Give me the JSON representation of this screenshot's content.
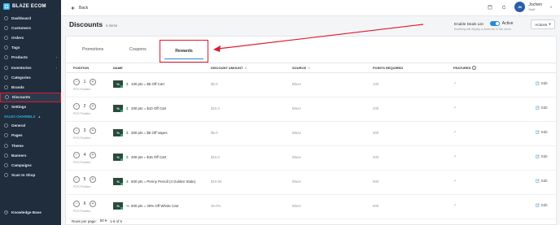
{
  "brand": {
    "name": "BLAZE ECOM"
  },
  "sidebar": {
    "items": [
      {
        "label": "Dashboard",
        "icon": "dashboard-icon"
      },
      {
        "label": "Customers",
        "icon": "people-icon"
      },
      {
        "label": "Orders",
        "icon": "orders-icon"
      },
      {
        "label": "Tags",
        "icon": "tag-icon"
      },
      {
        "label": "Products",
        "icon": "box-icon"
      },
      {
        "label": "Inventories",
        "icon": "inventory-icon"
      },
      {
        "label": "Categories",
        "icon": "category-icon"
      },
      {
        "label": "Brands",
        "icon": "brand-icon"
      },
      {
        "label": "Discounts",
        "icon": "discount-icon",
        "active": true
      },
      {
        "label": "Settings",
        "icon": "gear-icon"
      }
    ],
    "section_label": "SALES CHANNELS",
    "channel_items": [
      {
        "label": "General",
        "icon": "globe-icon"
      },
      {
        "label": "Pages",
        "icon": "pages-icon"
      },
      {
        "label": "Theme",
        "icon": "theme-icon"
      },
      {
        "label": "Banners",
        "icon": "banner-icon"
      },
      {
        "label": "Campaigns",
        "icon": "campaign-icon"
      },
      {
        "label": "Scan to Shop",
        "icon": "scan-icon"
      }
    ],
    "bottom_item": {
      "label": "Knowledge Base",
      "icon": "help-icon"
    }
  },
  "topbar": {
    "back_label": "Back",
    "user": {
      "initials": "JK",
      "name": "Jochen",
      "role": "Staff"
    }
  },
  "page": {
    "title": "Discounts",
    "count": "6 items",
    "deals_label": "Enable Deals List",
    "deals_state": "Active",
    "deals_hint": "Enabling will display a deals list in the menu",
    "actions_label": "Actions"
  },
  "tabs": {
    "promotions": "Promotions",
    "coupons": "Coupons",
    "rewards": "Rewards"
  },
  "columns": {
    "position": "POSITION",
    "name": "NAME",
    "discount_amount": "DISCOUNT AMOUNT",
    "source": "SOURCE",
    "points_required": "POINTS REQUIRED",
    "featured": "FEATURED"
  },
  "rows": [
    {
      "position": "1",
      "pos_label": "POS Position",
      "symbol": "$",
      "name": "100 pts = $5 Off Cart",
      "discount": "$5.0",
      "source": "Blaze",
      "points": "100",
      "edit": "Edit"
    },
    {
      "position": "2",
      "pos_label": "POS Position",
      "symbol": "$",
      "name": "200 pts = $10 Off Cart",
      "discount": "$10.0",
      "source": "Blaze",
      "points": "200",
      "edit": "Edit"
    },
    {
      "position": "3",
      "pos_label": "POS Position",
      "symbol": "$",
      "name": "300 pts = $5 Off Vapes",
      "discount": "$5.0",
      "source": "Blaze",
      "points": "300",
      "edit": "Edit"
    },
    {
      "position": "4",
      "pos_label": "POS Position",
      "symbol": "$",
      "name": "400 pts = $15 Off Cart",
      "discount": "$15.0",
      "source": "Blaze",
      "points": "400",
      "edit": "Edit"
    },
    {
      "position": "5",
      "pos_label": "POS Position",
      "symbol": "$",
      "name": "500 pts = Penny Preroll (4 Golden State)",
      "discount": "$19.96",
      "source": "Blaze",
      "points": "500",
      "edit": "Edit"
    },
    {
      "position": "6",
      "pos_label": "POS Position",
      "symbol": "%",
      "name": "600 pts = 30% Off Whole Cart",
      "discount": "30.0%",
      "source": "Blaze",
      "points": "600",
      "edit": "Edit"
    }
  ],
  "footer": {
    "rows_label": "Rows per page:",
    "rows_value": "50",
    "range": "1-6 of 6"
  },
  "colors": {
    "sidebar": "#1f2d3d",
    "accent": "#2a8ad8",
    "highlight": "#e0182d",
    "brand": "#2eb0e4"
  }
}
